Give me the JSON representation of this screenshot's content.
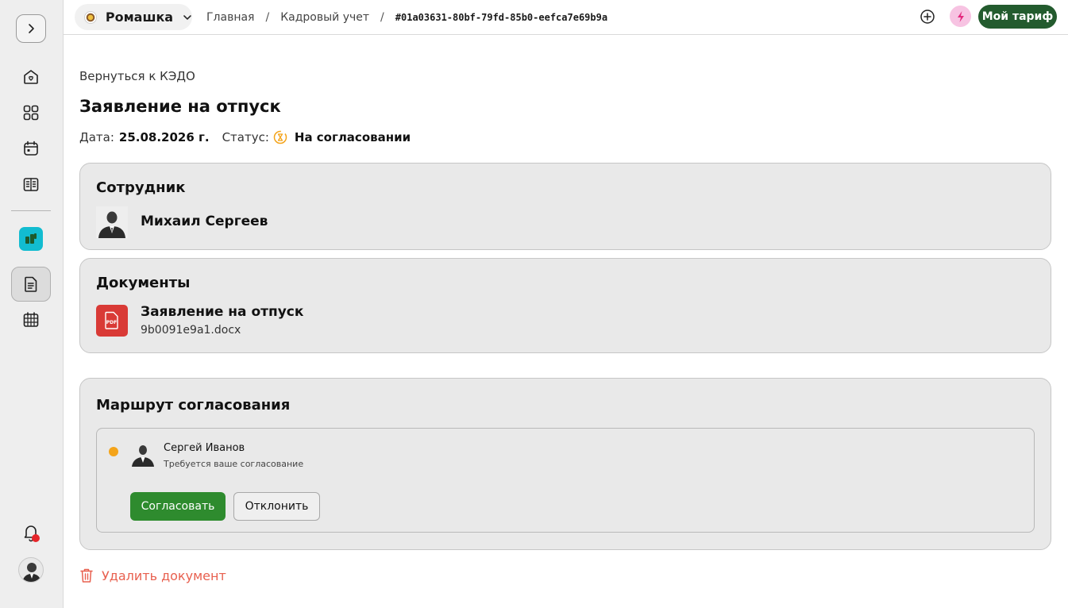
{
  "topbar": {
    "org_name": "Ромашка",
    "breadcrumbs": [
      "Главная",
      "Кадровый учет",
      "#01a03631-80bf-79fd-85b0-eefca7e69b9a"
    ],
    "tariff_button": "Мой тариф"
  },
  "page": {
    "back_link": "Вернуться к КЭДО",
    "title": "Заявление на отпуск",
    "date_label": "Дата:",
    "date_value": "25.08.2026 г.",
    "status_label": "Статус:",
    "status_value": "На согласовании"
  },
  "employee_card": {
    "title": "Сотрудник",
    "name": "Михаил Сергеев"
  },
  "documents_card": {
    "title": "Документы",
    "doc_title": "Заявление на отпуск",
    "doc_file": "9b0091e9a1.docx",
    "doc_icon_label": "PDF"
  },
  "route_card": {
    "title": "Маршрут согласования",
    "approver_name": "Сергей Иванов",
    "approver_note": "Требуется ваше согласование",
    "approve_label": "Согласовать",
    "reject_label": "Отклонить"
  },
  "delete_label": "Удалить документ",
  "icons": {
    "sidebar": [
      "chevron-right-icon",
      "home-icon",
      "grid-icon",
      "calendar-icon",
      "book-icon",
      "app-icon",
      "document-icon",
      "table-icon",
      "bell-icon",
      "avatar"
    ],
    "topbar": [
      "plus-circle-icon",
      "bolt-icon"
    ]
  },
  "colors": {
    "tariff_bg": "#235b2e",
    "approve_bg": "#2e8b2e",
    "status_dot": "#f4a41a",
    "delete": "#e8604f",
    "doc_icon_bg": "#d93a36",
    "app_icon_bg": "#12bcd0",
    "bolt_bg": "#f7c3e2",
    "bolt": "#e4287e"
  }
}
